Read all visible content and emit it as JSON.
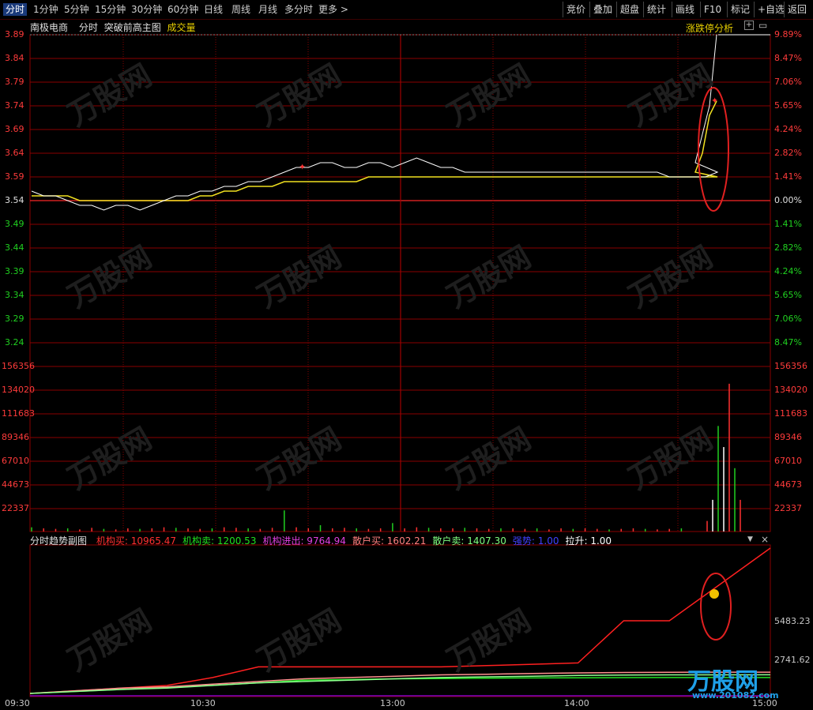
{
  "toolbar": {
    "periods": [
      "分时",
      "1分钟",
      "5分钟",
      "15分钟",
      "30分钟",
      "60分钟",
      "日线",
      "周线",
      "月线",
      "多分时",
      "更多 >"
    ],
    "right_buttons": [
      "竞价",
      "叠加",
      "超盘",
      "统计",
      "画线",
      "F10",
      "标记",
      "+自选",
      "返回"
    ]
  },
  "header": {
    "stock_name": "南极电商",
    "chart_mode": "分时",
    "main_indicator": "突破前高主图",
    "volume_label": "成交量",
    "limit_analysis": "涨跌停分析",
    "plus_icon": "+",
    "menu_icon": "▭"
  },
  "price_axis": {
    "left": [
      "3.89",
      "3.84",
      "3.79",
      "3.74",
      "3.69",
      "3.64",
      "3.59",
      "3.54",
      "3.49",
      "3.44",
      "3.39",
      "3.34",
      "3.29",
      "3.24"
    ],
    "right": [
      "9.89%",
      "8.47%",
      "7.06%",
      "5.65%",
      "4.24%",
      "2.82%",
      "1.41%",
      "0.00%",
      "1.41%",
      "2.82%",
      "4.24%",
      "5.65%",
      "7.06%",
      "8.47%"
    ],
    "prev_close": 3.54,
    "max": 3.89
  },
  "volume_axis": {
    "left": [
      "156356",
      "134020",
      "111683",
      "89346",
      "67010",
      "44673",
      "22337"
    ],
    "right": [
      "156356",
      "134020",
      "111683",
      "89346",
      "67010",
      "44673",
      "22337"
    ]
  },
  "indicator": {
    "name": "分时趋势副图",
    "items": [
      {
        "label": "机构买:",
        "value": "10965.47",
        "color": "#ff3030"
      },
      {
        "label": "机构卖:",
        "value": "1200.53",
        "color": "#20e020"
      },
      {
        "label": "机构进出:",
        "value": "9764.94",
        "color": "#e040e0"
      },
      {
        "label": "散户买:",
        "value": "1602.21",
        "color": "#ff8080"
      },
      {
        "label": "散户卖:",
        "value": "1407.30",
        "color": "#80ff80"
      },
      {
        "label": "强势:",
        "value": "1.00",
        "color": "#4040ff"
      },
      {
        "label": "拉升:",
        "value": "1.00",
        "color": "#ffffff"
      }
    ],
    "right_axis": [
      "5483.23",
      "2741.62"
    ],
    "down_icon": "▼",
    "close_icon": "×"
  },
  "time_axis": [
    "09:30",
    "10:30",
    "13:00",
    "14:00",
    "15:00"
  ],
  "watermark": {
    "brand": "万股网",
    "site": "www.201082.com"
  },
  "logo": {
    "brand": "万股网",
    "site": "www.201082.com"
  },
  "chart_data": {
    "type": "line",
    "price_series": {
      "name": "",
      "color": "#ffffff",
      "values": [
        3.56,
        3.55,
        3.55,
        3.54,
        3.53,
        3.53,
        3.52,
        3.53,
        3.53,
        3.52,
        3.53,
        3.54,
        3.55,
        3.55,
        3.56,
        3.56,
        3.57,
        3.57,
        3.58,
        3.58,
        3.59,
        3.6,
        3.61,
        3.61,
        3.62,
        3.62,
        3.61,
        3.61,
        3.62,
        3.62,
        3.61,
        3.62,
        3.63,
        3.62,
        3.61,
        3.61,
        3.6,
        3.6,
        3.6,
        3.6,
        3.6,
        3.6,
        3.6,
        3.6,
        3.6,
        3.6,
        3.6,
        3.6,
        3.6,
        3.6,
        3.6,
        3.6,
        3.6,
        3.59,
        3.59,
        3.59,
        3.59,
        3.6,
        3.62,
        3.68,
        3.74,
        3.89
      ]
    },
    "avg_series": {
      "name": "",
      "color": "#f0e020",
      "values": [
        3.55,
        3.55,
        3.55,
        3.55,
        3.54,
        3.54,
        3.54,
        3.54,
        3.54,
        3.54,
        3.54,
        3.54,
        3.54,
        3.54,
        3.55,
        3.55,
        3.56,
        3.56,
        3.57,
        3.57,
        3.57,
        3.58,
        3.58,
        3.58,
        3.58,
        3.58,
        3.58,
        3.58,
        3.59,
        3.59,
        3.59,
        3.59,
        3.59,
        3.59,
        3.59,
        3.59,
        3.59,
        3.59,
        3.59,
        3.59,
        3.59,
        3.59,
        3.59,
        3.59,
        3.59,
        3.59,
        3.59,
        3.59,
        3.59,
        3.59,
        3.59,
        3.59,
        3.59,
        3.59,
        3.59,
        3.59,
        3.59,
        3.59,
        3.6,
        3.64,
        3.72,
        3.75
      ]
    },
    "volume": [
      4000,
      3000,
      2500,
      3000,
      2000,
      3500,
      2500,
      2000,
      3000,
      2500,
      3000,
      4000,
      3500,
      3000,
      2500,
      3000,
      4000,
      3500,
      3000,
      2500,
      3500,
      20000,
      4000,
      3000,
      6000,
      3000,
      3500,
      3000,
      2500,
      3000,
      8000,
      3000,
      4000,
      3500,
      3000,
      3000,
      3500,
      3000,
      2500,
      3000,
      3000,
      2500,
      3000,
      2000,
      3000,
      2500,
      3000,
      2500,
      2000,
      2500,
      3000,
      2500,
      2000,
      2500,
      3000,
      10000,
      30000,
      100000,
      80000,
      140000,
      60000,
      30000
    ],
    "indicator_series": [
      {
        "name": "机构买",
        "color": "#ff2020",
        "values": [
          0,
          200,
          400,
          600,
          1200,
          2000,
          2000,
          2000,
          2000,
          2000,
          2100,
          2200,
          2300,
          5483,
          5483,
          10965
        ]
      },
      {
        "name": "机构卖",
        "color": "#20e020",
        "values": [
          0,
          150,
          300,
          450,
          600,
          800,
          1000,
          1050,
          1100,
          1120,
          1150,
          1170,
          1180,
          1190,
          1200,
          1200
        ]
      },
      {
        "name": "散户买",
        "color": "#ff9090",
        "values": [
          0,
          200,
          400,
          500,
          700,
          900,
          1100,
          1200,
          1300,
          1400,
          1450,
          1500,
          1550,
          1580,
          1600,
          1602
        ]
      },
      {
        "name": "散户卖",
        "color": "#90ff90",
        "values": [
          0,
          150,
          300,
          400,
          600,
          800,
          900,
          1000,
          1100,
          1200,
          1250,
          1300,
          1350,
          1380,
          1400,
          1407
        ]
      }
    ],
    "indicator_ylim": [
      0,
      10965
    ]
  }
}
